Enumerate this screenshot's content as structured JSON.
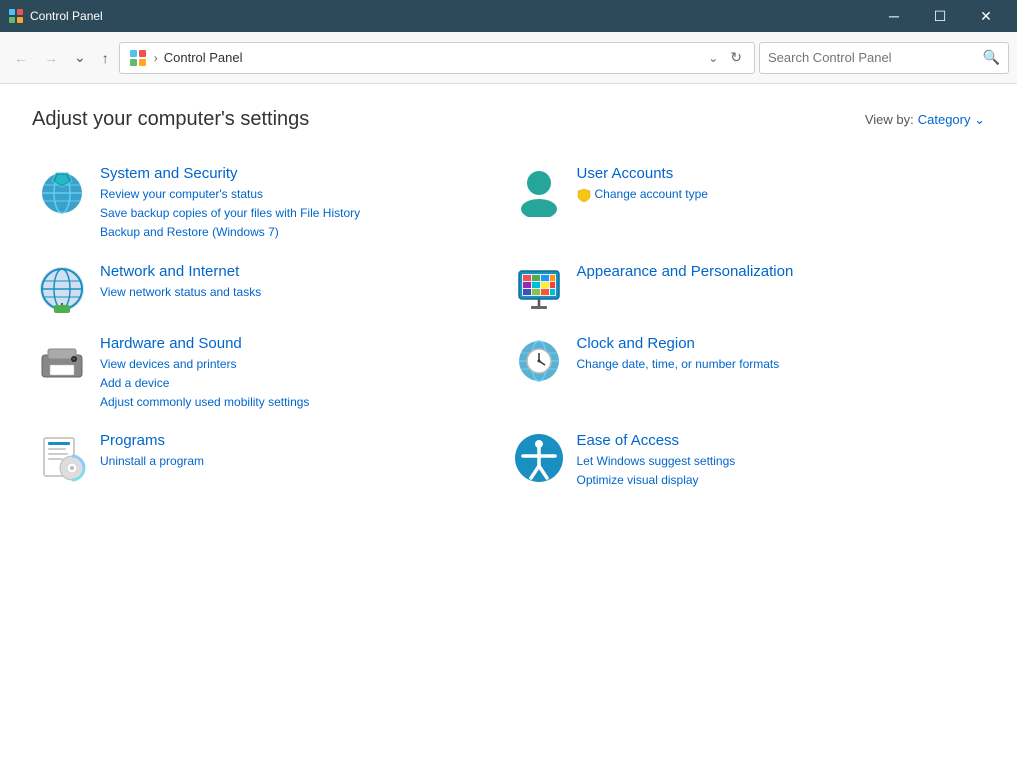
{
  "titlebar": {
    "icon_alt": "control-panel-icon",
    "title": "Control Panel",
    "btn_minimize": "─",
    "btn_maximize": "☐",
    "btn_close": "✕"
  },
  "navbar": {
    "back_tooltip": "Back",
    "forward_tooltip": "Forward",
    "recent_tooltip": "Recent locations",
    "up_tooltip": "Up",
    "address_text": "Control Panel",
    "refresh_tooltip": "Refresh",
    "search_placeholder": "Search Control Panel"
  },
  "main": {
    "page_title": "Adjust your computer's settings",
    "view_by_label": "View by:",
    "view_by_value": "Category",
    "categories": [
      {
        "id": "system-security",
        "title": "System and Security",
        "links": [
          "Review your computer's status",
          "Save backup copies of your files with File History",
          "Backup and Restore (Windows 7)"
        ]
      },
      {
        "id": "user-accounts",
        "title": "User Accounts",
        "links": [
          "Change account type"
        ]
      },
      {
        "id": "network-internet",
        "title": "Network and Internet",
        "links": [
          "View network status and tasks"
        ]
      },
      {
        "id": "appearance-personalization",
        "title": "Appearance and Personalization",
        "links": []
      },
      {
        "id": "hardware-sound",
        "title": "Hardware and Sound",
        "links": [
          "View devices and printers",
          "Add a device",
          "Adjust commonly used mobility settings"
        ]
      },
      {
        "id": "clock-region",
        "title": "Clock and Region",
        "links": [
          "Change date, time, or number formats"
        ]
      },
      {
        "id": "programs",
        "title": "Programs",
        "links": [
          "Uninstall a program"
        ]
      },
      {
        "id": "ease-of-access",
        "title": "Ease of Access",
        "links": [
          "Let Windows suggest settings",
          "Optimize visual display"
        ]
      }
    ]
  }
}
